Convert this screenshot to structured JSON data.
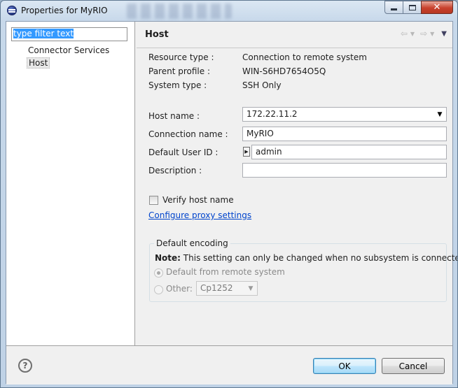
{
  "window": {
    "title": "Properties for MyRIO"
  },
  "filter": {
    "value": "type filter text"
  },
  "tree": {
    "items": [
      {
        "label": "Connector Services"
      },
      {
        "label": "Host"
      }
    ]
  },
  "page": {
    "title": "Host"
  },
  "info": {
    "resource_type_label": "Resource type :",
    "resource_type_value": "Connection to remote system",
    "parent_profile_label": "Parent profile :",
    "parent_profile_value": "WIN-S6HD7654O5Q",
    "system_type_label": "System type :",
    "system_type_value": "SSH Only"
  },
  "form": {
    "host_name_label": "Host name :",
    "host_name_value": "172.22.11.2",
    "connection_name_label": "Connection name :",
    "connection_name_value": "MyRIO",
    "user_id_label": "Default User ID :",
    "user_id_value": "admin",
    "description_label": "Description :",
    "description_value": "",
    "verify_host_label": "Verify host name",
    "proxy_link": "Configure proxy settings"
  },
  "encoding": {
    "group_title": "Default encoding",
    "note_bold": "Note:",
    "note_text": "This setting can only be changed when no subsystem is connected",
    "default_option": "Default from remote system",
    "other_option": "Other:",
    "other_value": "Cp1252"
  },
  "buttons": {
    "ok": "OK",
    "cancel": "Cancel",
    "help": "?"
  },
  "icons": {
    "title": "app-icon",
    "back": "back-arrow-icon",
    "forward": "forward-arrow-icon",
    "menu": "view-menu-icon",
    "help": "help-icon"
  }
}
